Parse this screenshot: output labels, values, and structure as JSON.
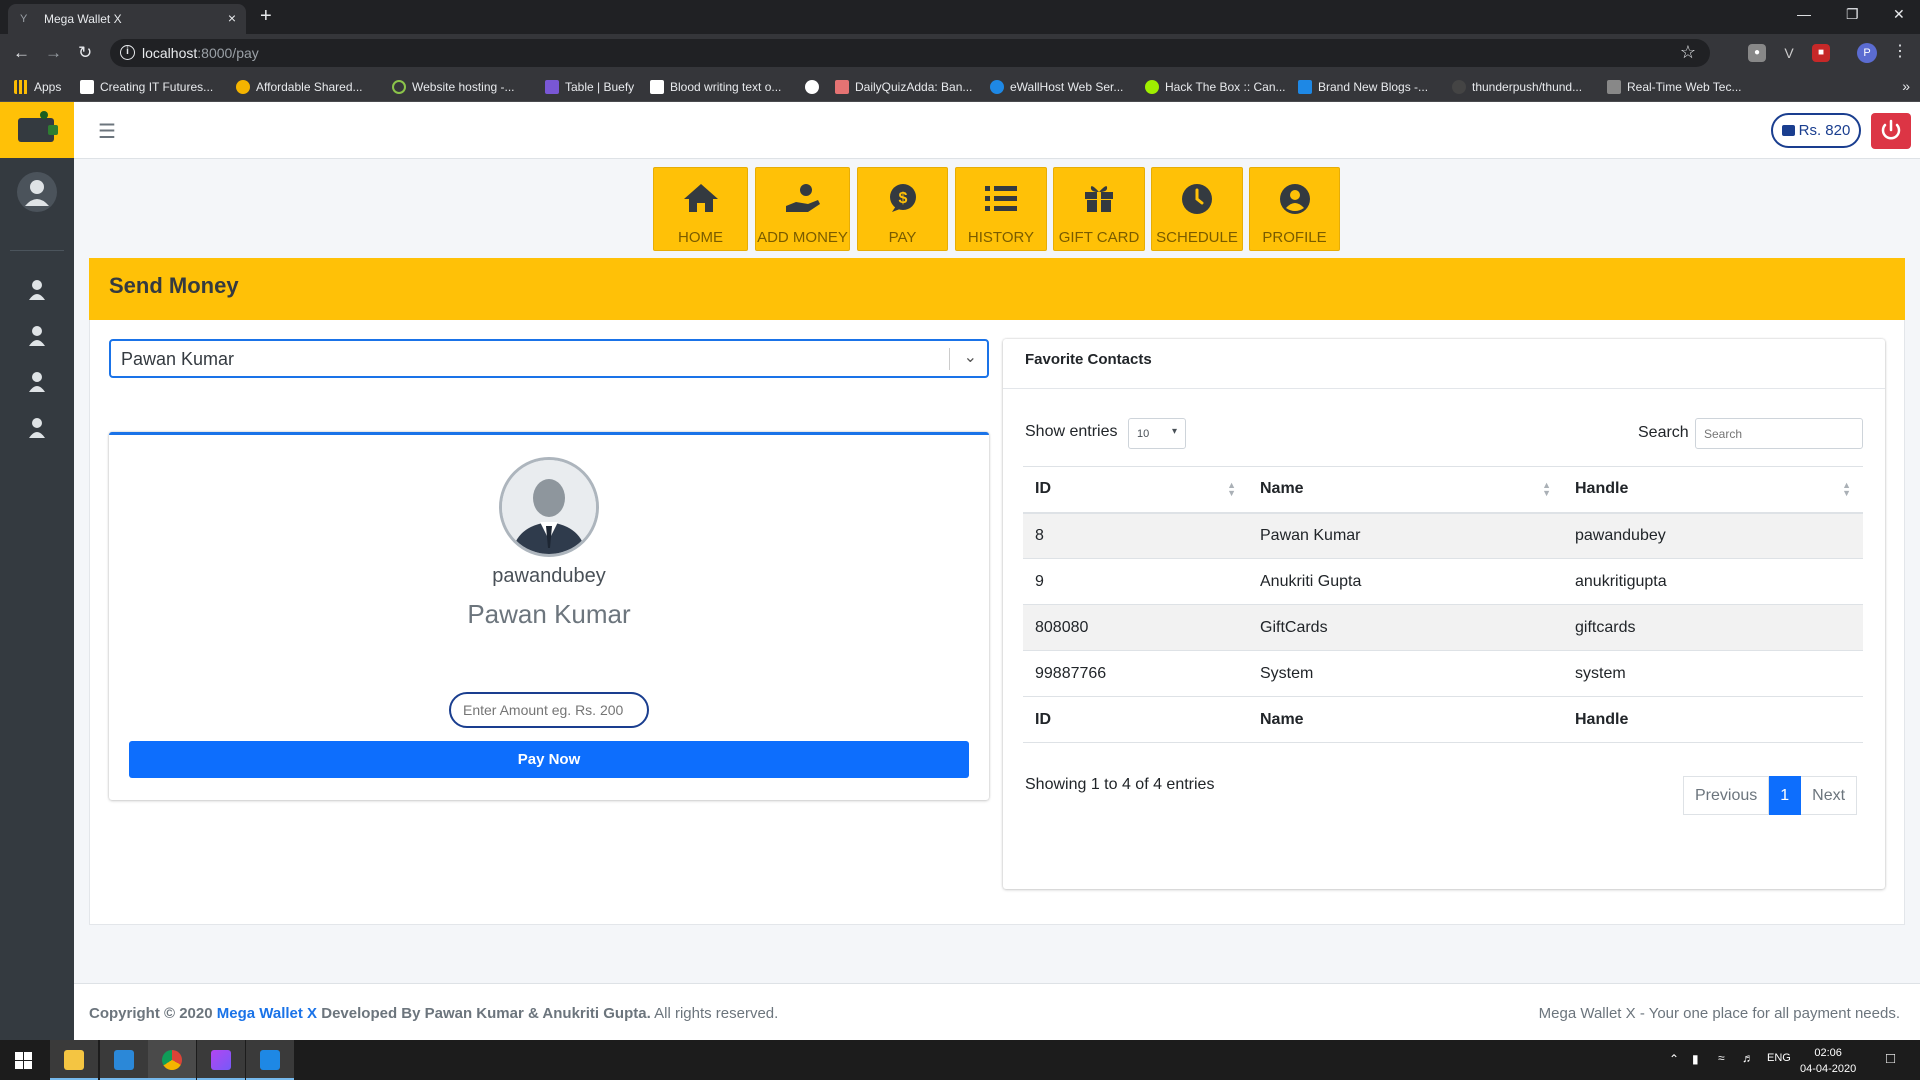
{
  "browser": {
    "tab_title": "Mega Wallet X",
    "tab_close": "×",
    "new_tab": "+",
    "url_host": "localhost",
    "url_path": ":8000/pay",
    "bookmarks": [
      "Apps",
      "Creating IT Futures...",
      "Affordable Shared...",
      "Website hosting -...",
      "Table | Buefy",
      "Blood writing text o...",
      "",
      "DailyQuizAdda: Ban...",
      "eWallHost Web Ser...",
      "Hack The Box :: Can...",
      "Brand New Blogs -...",
      "thunderpush/thund...",
      "Real-Time Web Tec..."
    ],
    "profile_initial": "P"
  },
  "topnav": {
    "balance": "Rs. 820"
  },
  "quicknav": [
    {
      "label": "HOME",
      "icon": "home-icon"
    },
    {
      "label": "ADD MONEY",
      "icon": "add-money-icon"
    },
    {
      "label": "PAY",
      "icon": "pay-icon"
    },
    {
      "label": "HISTORY",
      "icon": "history-icon"
    },
    {
      "label": "GIFT CARD",
      "icon": "gift-card-icon"
    },
    {
      "label": "SCHEDULE",
      "icon": "schedule-icon"
    },
    {
      "label": "PROFILE",
      "icon": "profile-icon"
    }
  ],
  "page": {
    "title": "Send Money"
  },
  "send": {
    "selected_contact": "Pawan Kumar",
    "handle": "pawandubey",
    "name": "Pawan Kumar",
    "amount_placeholder": "Enter Amount eg. Rs. 200",
    "pay_button": "Pay Now"
  },
  "favorites": {
    "title": "Favorite Contacts",
    "show_entries_label": "Show entries",
    "entries_value": "10",
    "search_label": "Search",
    "search_placeholder": "Search",
    "columns": [
      "ID",
      "Name",
      "Handle"
    ],
    "rows": [
      {
        "id": "8",
        "name": "Pawan Kumar",
        "handle": "pawandubey"
      },
      {
        "id": "9",
        "name": "Anukriti Gupta",
        "handle": "anukritigupta"
      },
      {
        "id": "808080",
        "name": "GiftCards",
        "handle": "giftcards"
      },
      {
        "id": "99887766",
        "name": "System",
        "handle": "system"
      }
    ],
    "showing_text": "Showing 1 to 4 of 4 entries",
    "pager": {
      "previous": "Previous",
      "current": "1",
      "next": "Next"
    }
  },
  "footer": {
    "copyright_prefix": "Copyright © 2020",
    "brand": "Mega Wallet X",
    "developed_by": "Developed By Pawan Kumar & Anukriti Gupta.",
    "rights": "All rights reserved.",
    "tagline": "Mega Wallet X - Your one place for all payment needs."
  },
  "taskbar": {
    "lang": "ENG",
    "time": "02:06",
    "date": "04-04-2020"
  },
  "colors": {
    "accent_yellow": "#ffc107",
    "sidebar_dark": "#343a40",
    "primary_blue": "#0d6efd",
    "danger_red": "#dc3545"
  }
}
